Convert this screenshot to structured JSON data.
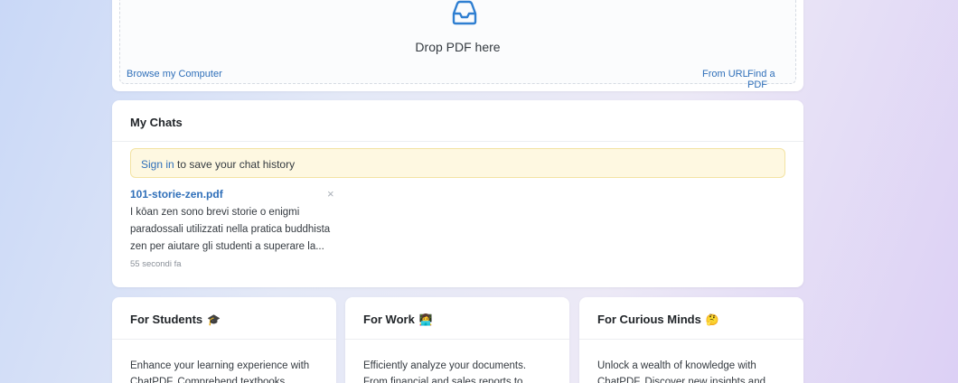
{
  "upload": {
    "drop_label": "Drop PDF here",
    "browse_label": "Browse my Computer",
    "from_url_label": "From URL",
    "find_pdf_label": "Find a PDF",
    "accent_color": "#2f6fb9"
  },
  "chats": {
    "title": "My Chats",
    "notice": {
      "signin_label": "Sign in",
      "text": " to save your chat history"
    },
    "items": [
      {
        "title": "101-storie-zen.pdf",
        "close_label": "×",
        "summary": "I kōan zen sono brevi storie o enigmi paradossali utilizzati nella pratica buddhista zen per aiutare gli studenti a superare la...",
        "time": "55 secondi fa"
      }
    ]
  },
  "categories": [
    {
      "title": "For Students",
      "emoji": "🎓",
      "text": "Enhance your learning experience with ChatPDF. Comprehend textbooks,"
    },
    {
      "title": "For Work",
      "emoji": "👩‍💻",
      "text": "Efficiently analyze your documents. From financial and sales reports to"
    },
    {
      "title": "For Curious Minds",
      "emoji": "🤔",
      "text": "Unlock a wealth of knowledge with ChatPDF. Discover new insights and"
    }
  ]
}
